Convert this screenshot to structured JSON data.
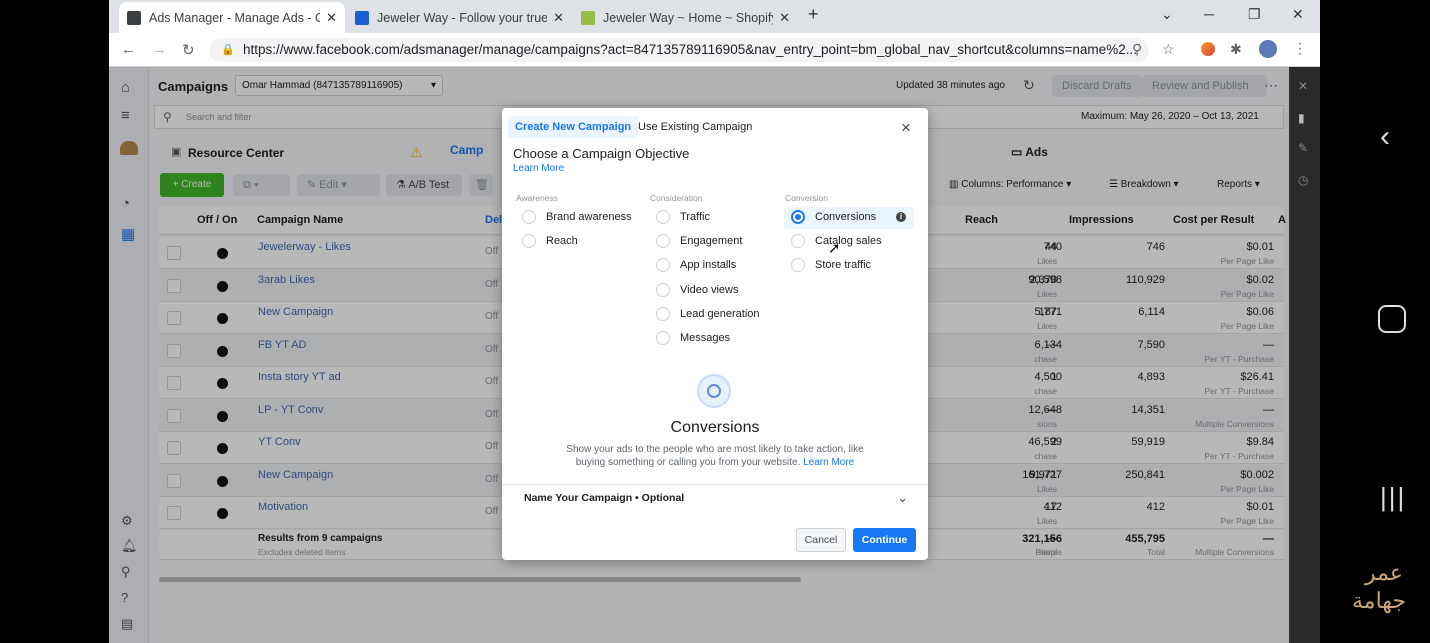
{
  "browser": {
    "tabs": [
      {
        "title": "Ads Manager - Manage Ads - Ca",
        "fav_color": "#3c4043"
      },
      {
        "title": "Jeweler Way - Follow your true p",
        "fav_color": "#1a5fd0"
      },
      {
        "title": "Jeweler Way ~ Home ~ Shopify",
        "fav_color": "#95bf47"
      }
    ],
    "new_tab": "+",
    "url": "https://www.facebook.com/adsmanager/manage/campaigns?act=847135789116905&nav_entry_point=bm_global_nav_shortcut&columns=name%2..."
  },
  "header": {
    "title": "Campaigns",
    "account": "Omar Hammad (847135789116905)",
    "updated": "Updated 38 minutes ago",
    "discard": "Discard Drafts",
    "review": "Review and Publish",
    "search_placeholder": "Search and filter",
    "date_range": "Maximum: May 26, 2020 – Oct 13, 2021",
    "resource_center": "Resource Center",
    "campaigns_tab": "Camp",
    "ads_tab": "Ads"
  },
  "toolbar": {
    "create": "+ Create",
    "edit": "Edit",
    "ab_test": "A/B Test",
    "columns": "Columns: Performance",
    "breakdown": "Breakdown",
    "reports": "Reports"
  },
  "table": {
    "headers": {
      "off_on": "Off / On",
      "name": "Campaign Name",
      "deli": "Deli",
      "reach": "Reach",
      "impressions": "Impressions",
      "cpr": "Cost per Result",
      "a": "A"
    },
    "rows": [
      {
        "name": "Jewelerway - Likes",
        "status": "Off",
        "results": "44",
        "results_sub": "Likes",
        "reach": "740",
        "impressions": "746",
        "cpr": "$0.01",
        "cpr_sub": "Per Page Like"
      },
      {
        "name": "3arab Likes",
        "status": "Off",
        "results": "2,370",
        "results_sub": "Likes",
        "reach": "90,598",
        "impressions": "110,929",
        "cpr": "$0.02",
        "cpr_sub": "Per Page Like"
      },
      {
        "name": "New Campaign",
        "status": "Off",
        "results": "187",
        "results_sub": "Likes",
        "reach": "5,771",
        "impressions": "6,114",
        "cpr": "$0.06",
        "cpr_sub": "Per Page Like"
      },
      {
        "name": "FB YT AD",
        "status": "Off",
        "results": "—",
        "results_sub": "chase",
        "reach": "6,134",
        "impressions": "7,590",
        "cpr": "—",
        "cpr_sub": "Per YT - Purchase"
      },
      {
        "name": "Insta story YT ad",
        "status": "Off",
        "results": "1",
        "results_sub": "chase",
        "reach": "4,500",
        "impressions": "4,893",
        "cpr": "$26.41",
        "cpr_sub": "Per YT - Purchase"
      },
      {
        "name": "LP - YT Conv",
        "status": "Off",
        "results": "—",
        "results_sub": "sions",
        "reach": "12,648",
        "impressions": "14,351",
        "cpr": "—",
        "cpr_sub": "Multiple Conversions"
      },
      {
        "name": "YT Conv",
        "status": "Off",
        "results": "2",
        "results_sub": "chase",
        "reach": "46,599",
        "impressions": "59,919",
        "cpr": "$9.84",
        "cpr_sub": "Per YT - Purchase"
      },
      {
        "name": "New Campaign",
        "status": "Off",
        "results": "9,971",
        "results_sub": "Likes",
        "reach": "161,727",
        "impressions": "250,841",
        "cpr": "$0.002",
        "cpr_sub": "Per Page Like"
      },
      {
        "name": "Motivation",
        "status": "Off",
        "results": "17",
        "results_sub": "Likes",
        "reach": "412",
        "impressions": "412",
        "cpr": "$0.01",
        "cpr_sub": "Per Page Like"
      }
    ],
    "summary": {
      "label": "Results from 9 campaigns",
      "sub": "Excludes deleted items",
      "results": "—",
      "results_sub": "sions",
      "reach": "321,156",
      "reach_sub": "People",
      "impressions": "455,795",
      "impressions_sub": "Total",
      "cpr": "—",
      "cpr_sub": "Multiple Conversions"
    }
  },
  "modal": {
    "tab_new": "Create New Campaign",
    "tab_existing": "Use Existing Campaign",
    "title": "Choose a Campaign Objective",
    "learn_more": "Learn More",
    "close": "×",
    "groups": {
      "awareness": {
        "label": "Awareness",
        "options": [
          "Brand awareness",
          "Reach"
        ]
      },
      "consideration": {
        "label": "Consideration",
        "options": [
          "Traffic",
          "Engagement",
          "App installs",
          "Video views",
          "Lead generation",
          "Messages"
        ]
      },
      "conversion": {
        "label": "Conversion",
        "options": [
          "Conversions",
          "Catalog sales",
          "Store traffic"
        ]
      }
    },
    "selected_option": "Conversions",
    "info_icon": "i",
    "detail_title": "Conversions",
    "detail_text": "Show your ads to the people who are most likely to take action, like buying something or calling you from your website.",
    "detail_link": "Learn More",
    "name_section": "Name Your Campaign • Optional",
    "cancel": "Cancel",
    "continue": "Continue",
    "accent": "#1877f2"
  },
  "watermark": {
    "line1": "عمر",
    "line2": "جهامة",
    "color": "#c9a66b"
  }
}
